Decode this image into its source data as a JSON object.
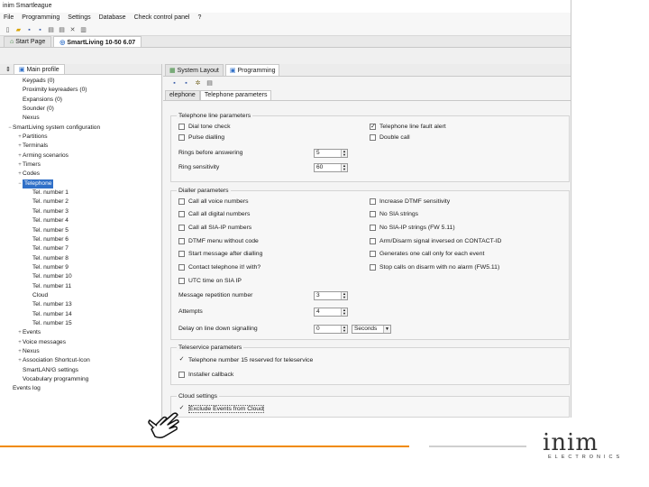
{
  "colors": {
    "accent": "#f18a00",
    "selection": "#3070c8"
  },
  "app": {
    "title": "inim Smartleague",
    "menu": [
      "File",
      "Programming",
      "Settings",
      "Database",
      "Check control panel",
      "?"
    ],
    "doc_tabs": [
      "Start Page",
      "SmartLiving 10-50 6.07"
    ]
  },
  "left_pane": {
    "tab": "Main profile"
  },
  "tree": [
    {
      "label": "Keypads (0)",
      "level": 1,
      "exp": ""
    },
    {
      "label": "Proximity keyreaders (0)",
      "level": 1,
      "exp": ""
    },
    {
      "label": "Expansions (0)",
      "level": 1,
      "exp": ""
    },
    {
      "label": "Sounder (0)",
      "level": 1,
      "exp": ""
    },
    {
      "label": "Nexus",
      "level": 1,
      "exp": ""
    },
    {
      "label": "SmartLiving system configuration",
      "level": 0,
      "exp": "−"
    },
    {
      "label": "Partitions",
      "level": 1,
      "exp": "+"
    },
    {
      "label": "Terminals",
      "level": 1,
      "exp": "+"
    },
    {
      "label": "Arming scenarios",
      "level": 1,
      "exp": "+"
    },
    {
      "label": "Timers",
      "level": 1,
      "exp": "+"
    },
    {
      "label": "Codes",
      "level": 1,
      "exp": "+"
    },
    {
      "label": "Telephone",
      "level": 1,
      "exp": "−",
      "selected": true
    },
    {
      "label": "Tel. number 1",
      "level": 2,
      "exp": ""
    },
    {
      "label": "Tel. number 2",
      "level": 2,
      "exp": ""
    },
    {
      "label": "Tel. number 3",
      "level": 2,
      "exp": ""
    },
    {
      "label": "Tel. number 4",
      "level": 2,
      "exp": ""
    },
    {
      "label": "Tel. number 5",
      "level": 2,
      "exp": ""
    },
    {
      "label": "Tel. number 6",
      "level": 2,
      "exp": ""
    },
    {
      "label": "Tel. number 7",
      "level": 2,
      "exp": ""
    },
    {
      "label": "Tel. number 8",
      "level": 2,
      "exp": ""
    },
    {
      "label": "Tel. number 9",
      "level": 2,
      "exp": ""
    },
    {
      "label": "Tel. number 10",
      "level": 2,
      "exp": ""
    },
    {
      "label": "Tel. number 11",
      "level": 2,
      "exp": ""
    },
    {
      "label": "Cloud",
      "level": 2,
      "exp": ""
    },
    {
      "label": "Tel. number 13",
      "level": 2,
      "exp": ""
    },
    {
      "label": "Tel. number 14",
      "level": 2,
      "exp": ""
    },
    {
      "label": "Tel. number 15",
      "level": 2,
      "exp": ""
    },
    {
      "label": "Events",
      "level": 1,
      "exp": "+"
    },
    {
      "label": "Voice messages",
      "level": 1,
      "exp": "+"
    },
    {
      "label": "Nexus",
      "level": 1,
      "exp": "+"
    },
    {
      "label": "Association Shortcut-Icon",
      "level": 1,
      "exp": "+"
    },
    {
      "label": "SmartLAN/G settings",
      "level": 1,
      "exp": ""
    },
    {
      "label": "Vocabulary programming",
      "level": 1,
      "exp": ""
    },
    {
      "label": "Events log",
      "level": 0,
      "exp": ""
    }
  ],
  "right_pane": {
    "tabs": [
      "System Layout",
      "Programming"
    ],
    "sub_tabs": [
      "elephone",
      "Telephone parameters"
    ]
  },
  "telephone_line": {
    "title": "Telephone line parameters",
    "left_checks": [
      {
        "label": "Dial tone check",
        "checked": false
      },
      {
        "label": "Pulse dialling",
        "checked": false
      }
    ],
    "right_checks": [
      {
        "label": "Telephone line fault alert",
        "checked": true
      },
      {
        "label": "Double call",
        "checked": false
      }
    ],
    "rings_label": "Rings before answering",
    "rings_value": "5",
    "sensitivity_label": "Ring sensitivity",
    "sensitivity_value": "60"
  },
  "dialler": {
    "title": "Dialler parameters",
    "left_checks": [
      {
        "label": "Call all voice numbers",
        "checked": false
      },
      {
        "label": "Call all digital numbers",
        "checked": false
      },
      {
        "label": "Call all SIA-IP numbers",
        "checked": false
      },
      {
        "label": "DTMF menu without code",
        "checked": false
      },
      {
        "label": "Start message after dialling",
        "checked": false
      },
      {
        "label": "Contact telephone it! with?",
        "checked": false
      },
      {
        "label": "UTC time on SIA IP",
        "checked": false
      }
    ],
    "right_checks": [
      {
        "label": "Increase DTMF sensitivity",
        "checked": false
      },
      {
        "label": "No SIA strings",
        "checked": false
      },
      {
        "label": "No SIA-IP strings (FW 5.11)",
        "checked": false
      },
      {
        "label": "Arm/Disarm signal inversed on CONTACT-ID",
        "checked": false
      },
      {
        "label": "Generates one call only for each event",
        "checked": false
      },
      {
        "label": "Stop calls on disarm with no alarm (FW5.11)",
        "checked": false
      }
    ],
    "repetition_label": "Message repetition number",
    "repetition_value": "3",
    "attempts_label": "Attempts",
    "attempts_value": "4",
    "delay_label": "Delay on line down signalling",
    "delay_value": "0",
    "delay_unit": "Seconds"
  },
  "teleservice": {
    "title": "Teleservice parameters",
    "checks": [
      {
        "label": "Telephone number 15 reserved for teleservice",
        "checked": true
      },
      {
        "label": "Installer callback",
        "checked": false
      }
    ]
  },
  "cloud": {
    "title": "Cloud settings",
    "checks": [
      {
        "label": "Exclude Events from Cloud",
        "checked": true
      }
    ]
  },
  "logo": {
    "word": "inim",
    "sub": "ELECTRONICS"
  }
}
